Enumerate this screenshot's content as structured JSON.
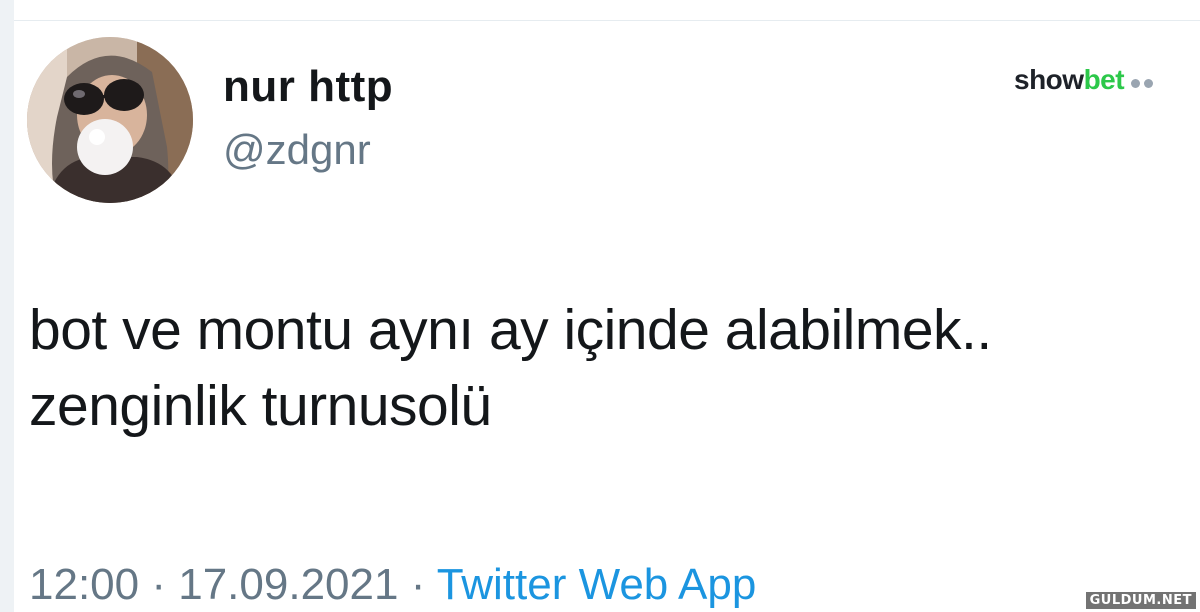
{
  "tweet": {
    "display_name": "nur http",
    "handle": "@zdgnr",
    "text_lines": [
      "bot ve montu aynı ay içinde alabilmek..",
      "zenginlik turnusolü"
    ],
    "time": "12:00",
    "date": "17.09.2021",
    "separator": "·",
    "source": "Twitter Web App"
  },
  "watermark": {
    "brand_part1": "show",
    "brand_part2": "bet",
    "site": "GULDUM.NET"
  },
  "colors": {
    "text_primary": "#14171a",
    "text_secondary": "#657786",
    "link_blue": "#1b95e0",
    "brand_green": "#2cc84a"
  },
  "icons": {
    "avatar": "profile-photo-avatar",
    "logo": "showbet-logo"
  }
}
